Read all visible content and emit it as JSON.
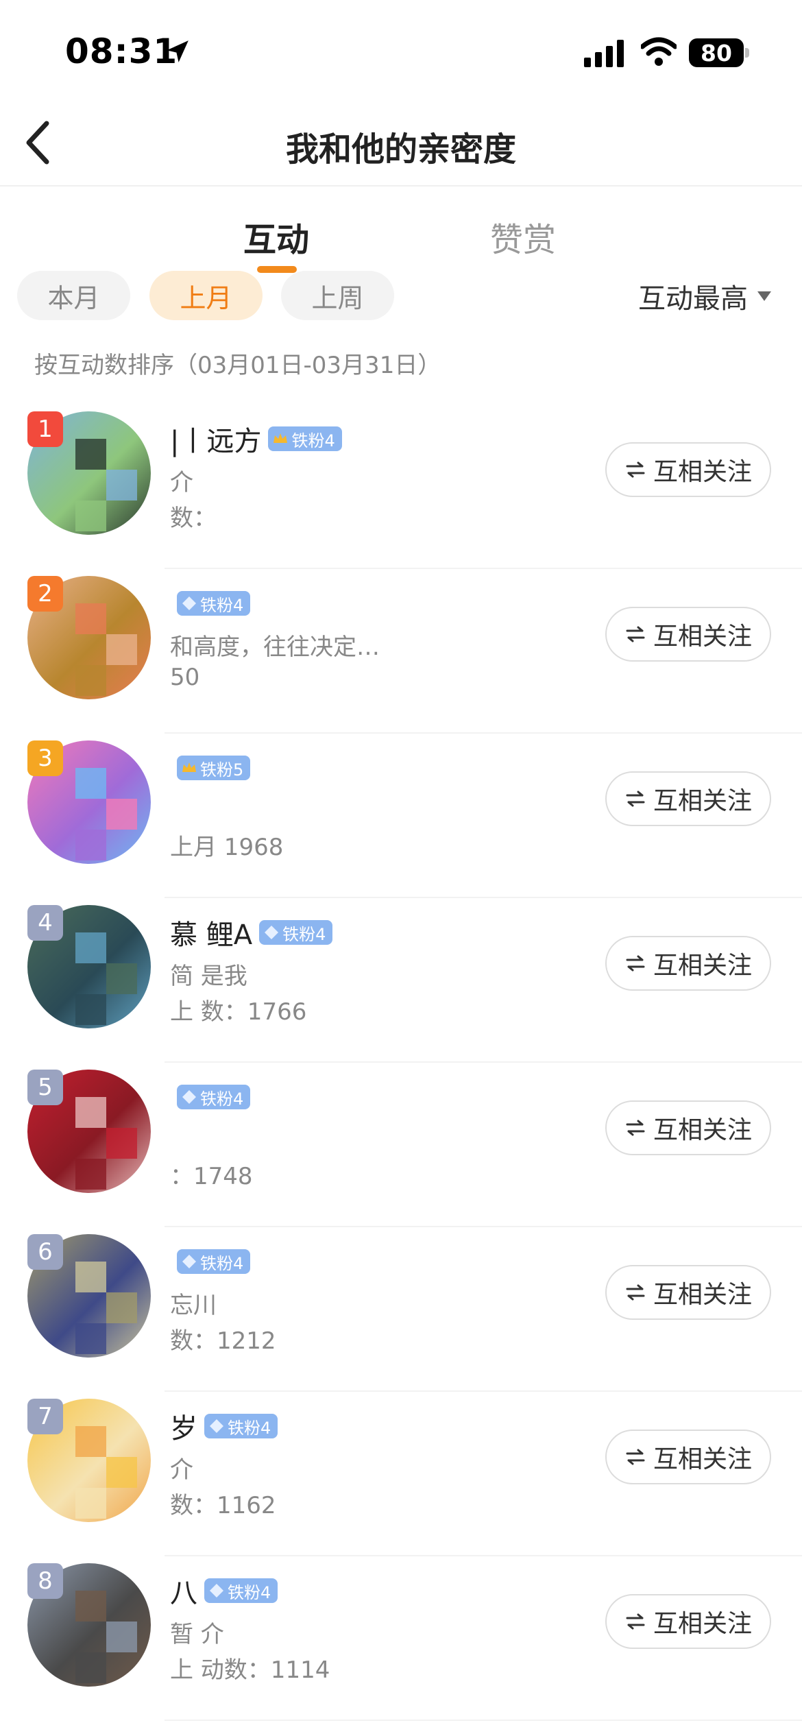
{
  "status_bar": {
    "time": "08:31",
    "battery": "80"
  },
  "nav": {
    "title": "我和他的亲密度"
  },
  "tabs": [
    {
      "label": "互动",
      "active": true
    },
    {
      "label": "赞赏",
      "active": false
    }
  ],
  "filters": {
    "chips": [
      {
        "label": "本月",
        "active": false
      },
      {
        "label": "上月",
        "active": true
      },
      {
        "label": "上周",
        "active": false
      }
    ],
    "sort": "互动最高"
  },
  "sort_desc": "按互动数排序（03月01日-03月31日）",
  "follow_label": "互相关注",
  "colors": {
    "accent": "#f28a1c",
    "badge": "#8bb5f0"
  },
  "rows": [
    {
      "rank": "1",
      "name": "|丨远方",
      "badge": "铁粉4",
      "badge_icon": "crown-icon",
      "bio": "介",
      "count": "数：",
      "avatar_colors": [
        "#7fb3d9",
        "#8ec67c",
        "#2b3a2f"
      ]
    },
    {
      "rank": "2",
      "name": "",
      "badge": "铁粉4",
      "badge_icon": "diamond-icon",
      "bio": "和高度，往往决定…",
      "count": "50",
      "avatar_colors": [
        "#e8b089",
        "#b8862f",
        "#e67c52"
      ]
    },
    {
      "rank": "3",
      "name": "",
      "badge": "铁粉5",
      "badge_icon": "crown-icon",
      "bio": "",
      "count": "上月 1968",
      "avatar_colors": [
        "#f27ab8",
        "#a06bd8",
        "#6fb7f2"
      ]
    },
    {
      "rank": "4",
      "name": "慕 鲤A",
      "badge": "铁粉4",
      "badge_icon": "diamond-icon",
      "bio": "简 是我",
      "count": "上 数：1766",
      "avatar_colors": [
        "#4a6b5a",
        "#2a4a56",
        "#5f9fbf"
      ]
    },
    {
      "rank": "5",
      "name": "",
      "badge": "铁粉4",
      "badge_icon": "diamond-icon",
      "bio": "",
      "count": "：1748",
      "avatar_colors": [
        "#c21f2f",
        "#8a1a24",
        "#e6b8b8"
      ]
    },
    {
      "rank": "6",
      "name": "",
      "badge": "铁粉4",
      "badge_icon": "diamond-icon",
      "bio": "忘川",
      "count": "数：1212",
      "avatar_colors": [
        "#a09a6c",
        "#3f4a88",
        "#c9c39a"
      ]
    },
    {
      "rank": "7",
      "name": "岁",
      "badge": "铁粉4",
      "badge_icon": "diamond-icon",
      "bio": "介",
      "count": "数：1162",
      "avatar_colors": [
        "#f6c64a",
        "#f5e2b0",
        "#f1a74c"
      ]
    },
    {
      "rank": "8",
      "name": "八",
      "badge": "铁粉4",
      "badge_icon": "diamond-icon",
      "bio": "暂 介",
      "count": "上 动数：1114",
      "avatar_colors": [
        "#8a96a8",
        "#4a4a4a",
        "#6f5a4a"
      ]
    }
  ]
}
